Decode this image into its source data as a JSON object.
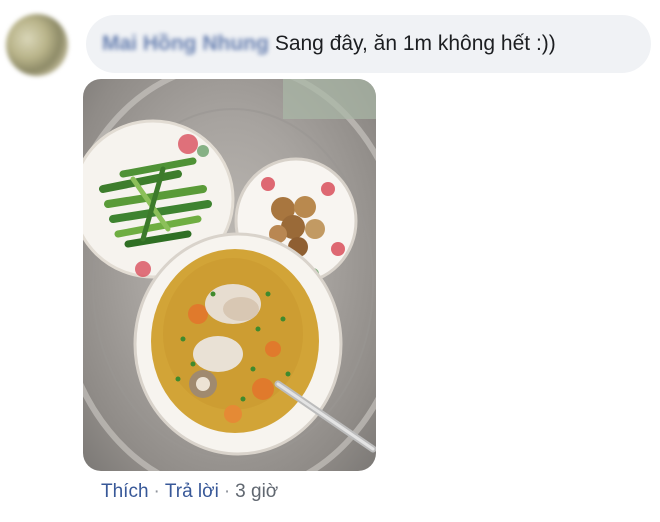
{
  "comment": {
    "author": "Mai Hồng Nhung",
    "text": "Sang đây, ăn 1m không hết :))"
  },
  "actions": {
    "like_label": "Thích",
    "reply_label": "Trả lời",
    "separator": "·",
    "timestamp": "3 giờ"
  }
}
